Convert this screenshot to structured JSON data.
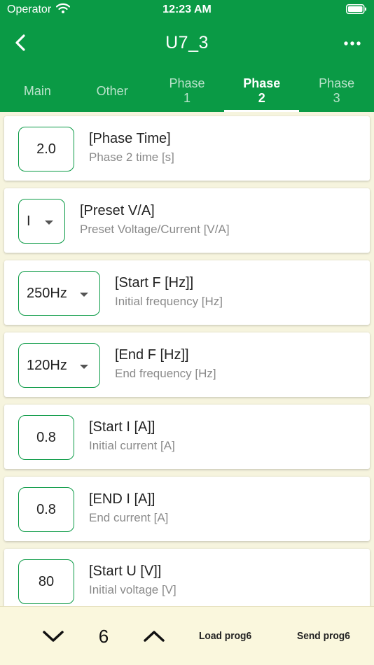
{
  "status_bar": {
    "carrier": "Operator",
    "time": "12:23 AM"
  },
  "nav": {
    "title": "U7_3"
  },
  "tabs": [
    {
      "line1": "Main",
      "line2": ""
    },
    {
      "line1": "Other",
      "line2": ""
    },
    {
      "line1": "Phase",
      "line2": "1"
    },
    {
      "line1": "Phase",
      "line2": "2"
    },
    {
      "line1": "Phase",
      "line2": "3"
    }
  ],
  "active_tab": "Phase 2",
  "params": [
    {
      "value": "2.0",
      "title": "[Phase Time]",
      "subtitle": "Phase 2 time [s]"
    },
    {
      "value": "I",
      "title": "[Preset V/A]",
      "subtitle": "Preset Voltage/Current [V/A]"
    },
    {
      "value": "250Hz",
      "title": "[Start F [Hz]]",
      "subtitle": "Initial frequency [Hz]"
    },
    {
      "value": "120Hz",
      "title": "[End F [Hz]]",
      "subtitle": "End frequency [Hz]"
    },
    {
      "value": "0.8",
      "title": "[Start I [A]]",
      "subtitle": "Initial current [A]"
    },
    {
      "value": "0.8",
      "title": "[END I [A]]",
      "subtitle": "End current [A]"
    },
    {
      "value": "80",
      "title": "[Start U [V]]",
      "subtitle": "Initial voltage [V]"
    }
  ],
  "footer": {
    "page": "6",
    "load_label": "Load prog6",
    "send_label": "Send prog6"
  },
  "colors": {
    "accent": "#0a9a45",
    "footer_bg": "#faf7dd",
    "page_bg": "#f6f4de"
  }
}
